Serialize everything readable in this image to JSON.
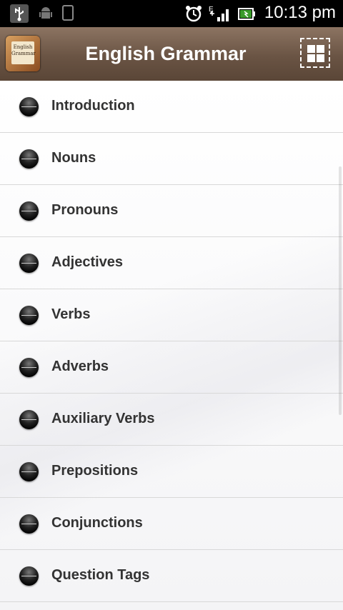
{
  "status_bar": {
    "time": "10:13 pm",
    "icons": [
      "usb-icon",
      "android-icon",
      "sdcard-icon",
      "alarm-clock-icon",
      "signal-edge-icon",
      "battery-icon"
    ],
    "network_label": "E"
  },
  "action_bar": {
    "title": "English Grammar",
    "logo_text": [
      "English",
      "Grammar"
    ],
    "menu_icon": "grid-menu-icon",
    "background": "#6a5444"
  },
  "list": {
    "items": [
      {
        "label": "Introduction"
      },
      {
        "label": "Nouns"
      },
      {
        "label": "Pronouns"
      },
      {
        "label": "Adjectives"
      },
      {
        "label": "Verbs"
      },
      {
        "label": "Adverbs"
      },
      {
        "label": "Auxiliary Verbs"
      },
      {
        "label": "Prepositions"
      },
      {
        "label": "Conjunctions"
      },
      {
        "label": "Question Tags"
      }
    ]
  }
}
